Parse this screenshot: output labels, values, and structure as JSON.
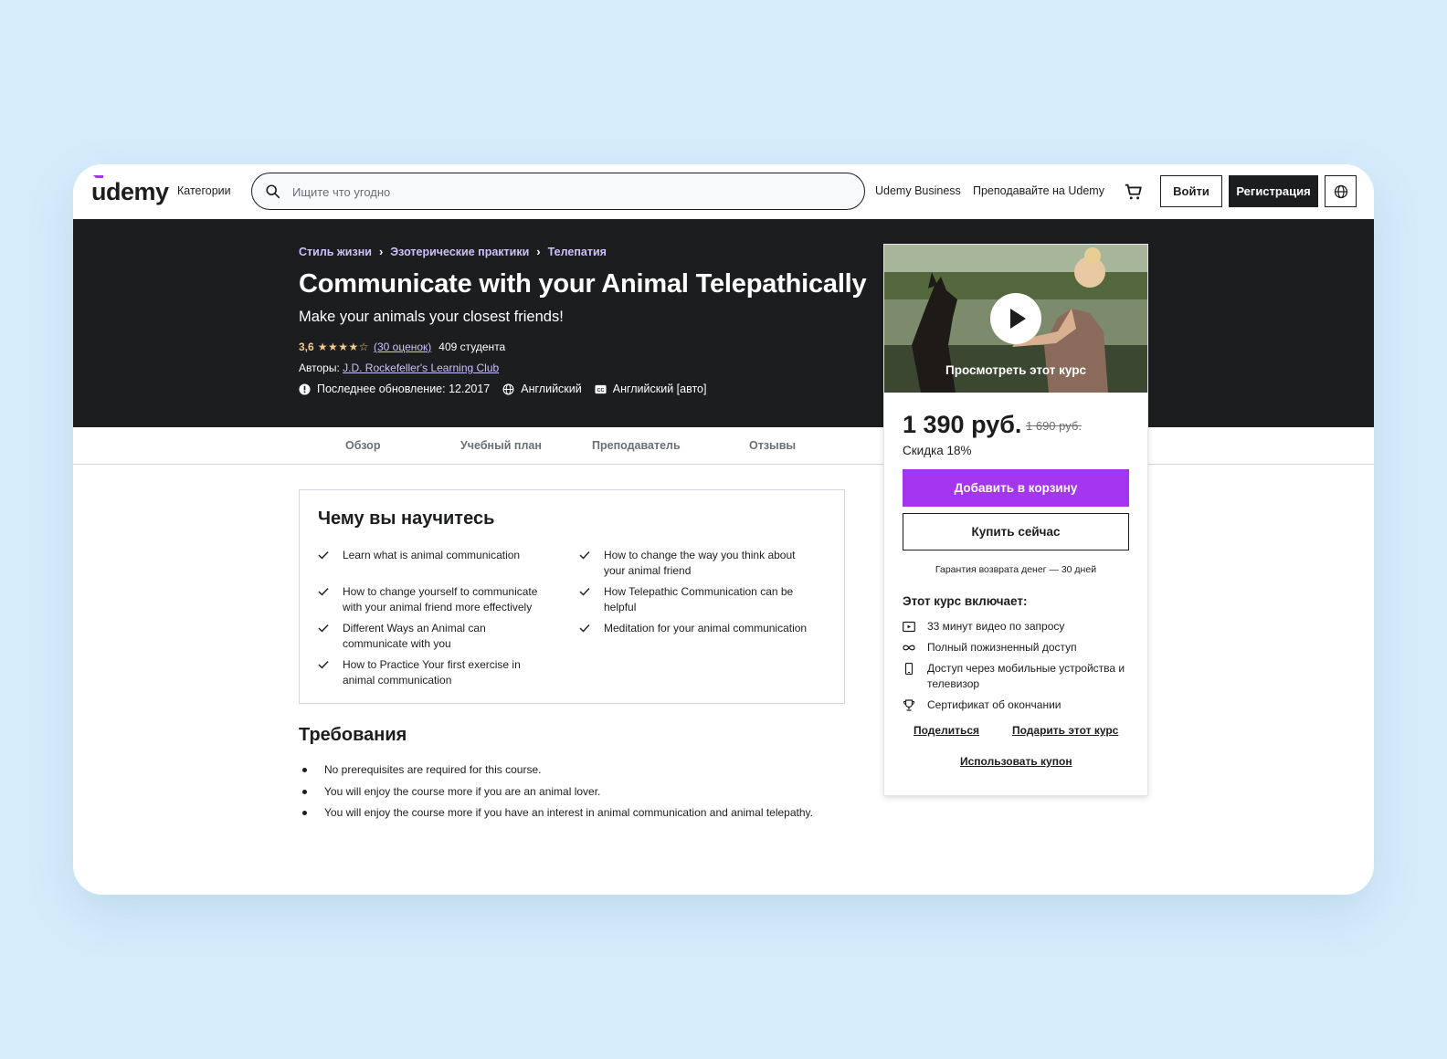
{
  "header": {
    "logo": "udemy",
    "categories": "Категории",
    "search_placeholder": "Ищите что угодно",
    "business": "Udemy Business",
    "teach": "Преподавайте на Udemy",
    "login": "Войти",
    "signup": "Регистрация"
  },
  "hero": {
    "breadcrumb": [
      "Стиль жизни",
      "Эзотерические практики",
      "Телепатия"
    ],
    "title": "Communicate with your Animal Telepathically",
    "subtitle": "Make your animals your closest friends!",
    "rating": "3,6",
    "stars": "★★★★☆",
    "ratings_link": "(30 оценок)",
    "students": "409 студента",
    "authors_label": "Авторы:",
    "author": "J.D. Rockefeller's Learning Club",
    "last_updated": "Последнее обновление: 12.2017",
    "language": "Английский",
    "captions": "Английский [авто]"
  },
  "tabs": [
    "Обзор",
    "Учебный план",
    "Преподаватель",
    "Отзывы"
  ],
  "learn": {
    "title": "Чему вы научитесь",
    "items": [
      "Learn what is animal communication",
      "How to change the way you think about your animal friend",
      "How to change yourself to communicate with your animal friend more effectively",
      "How Telepathic Communication can be helpful",
      "Different Ways an Animal can communicate with you",
      "Meditation for your animal communication",
      "How to Practice Your first exercise in animal communication"
    ]
  },
  "requirements": {
    "title": "Требования",
    "items": [
      "No prerequisites are required for this course.",
      "You will enjoy the course more if you are an animal lover.",
      "You will enjoy the course more if you have an interest in animal communication and animal telepathy."
    ]
  },
  "card": {
    "preview_label": "Просмотреть этот курс",
    "price": "1 390 руб.",
    "old_price": "1 690 руб.",
    "discount": "Скидка 18%",
    "add_to_cart": "Добавить в корзину",
    "buy_now": "Купить сейчас",
    "guarantee": "Гарантия возврата денег — 30 дней",
    "includes_title": "Этот курс включает:",
    "includes": [
      {
        "icon": "video-icon",
        "text": "33 минут видео по запросу"
      },
      {
        "icon": "infinity-icon",
        "text": "Полный пожизненный доступ"
      },
      {
        "icon": "mobile-icon",
        "text": "Доступ через мобильные устройства и телевизор"
      },
      {
        "icon": "trophy-icon",
        "text": "Сертификат об окончании"
      }
    ],
    "share": "Поделиться",
    "gift": "Подарить этот курс",
    "coupon": "Использовать купон"
  },
  "colors": {
    "accent": "#a435f0",
    "hero_bg": "#1c1d1f",
    "link_purple": "#cec0fc",
    "star": "#f3ca8c",
    "page_bg": "#d6ecfb"
  }
}
